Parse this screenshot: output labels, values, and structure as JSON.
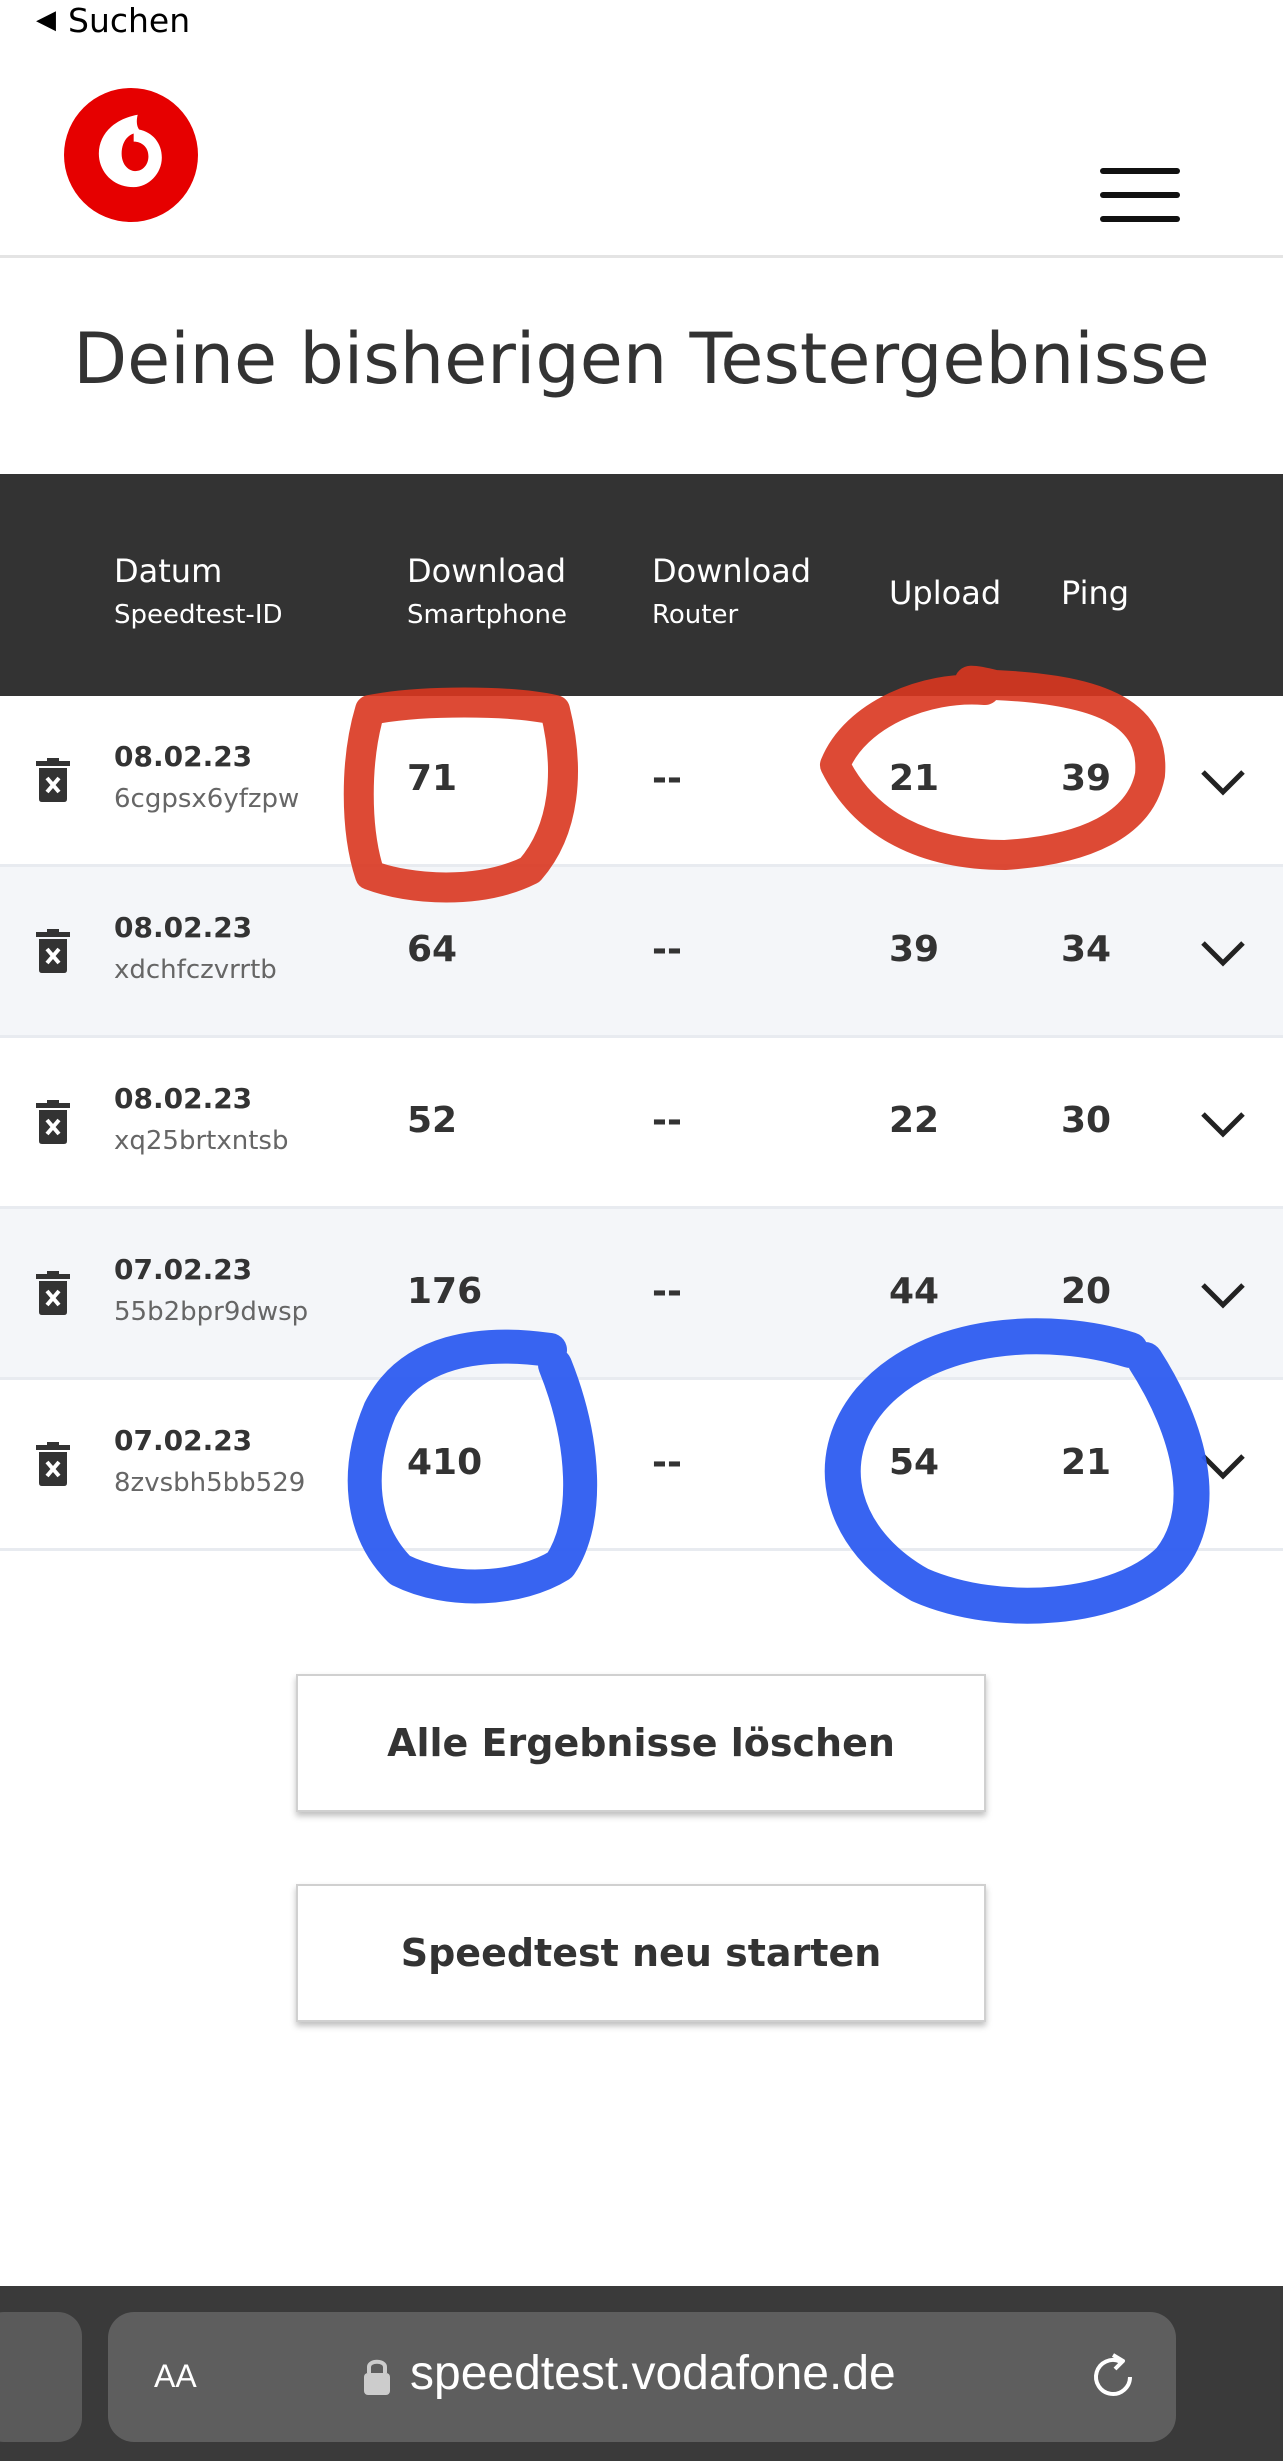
{
  "statusbar": {
    "back_label": "Suchen",
    "back_arrow": "◀"
  },
  "header": {
    "logo": "vodafone-logo",
    "menu_icon": "hamburger-menu-icon",
    "brand_color": "#e60000"
  },
  "page": {
    "title": "Deine bisherigen Testergebnisse"
  },
  "table": {
    "columns": [
      {
        "label": "Datum",
        "sublabel": "Speedtest-ID"
      },
      {
        "label": "Download",
        "sublabel": "Smartphone"
      },
      {
        "label": "Download",
        "sublabel": "Router"
      },
      {
        "label": "Upload",
        "sublabel": ""
      },
      {
        "label": "Ping",
        "sublabel": ""
      }
    ],
    "rows": [
      {
        "date": "08.02.23",
        "id": "6cgpsx6yfzpw",
        "download_smartphone": "71",
        "download_router": "--",
        "upload": "21",
        "ping": "39"
      },
      {
        "date": "08.02.23",
        "id": "xdchfczvrrtb",
        "download_smartphone": "64",
        "download_router": "--",
        "upload": "39",
        "ping": "34"
      },
      {
        "date": "08.02.23",
        "id": "xq25brtxntsb",
        "download_smartphone": "52",
        "download_router": "--",
        "upload": "22",
        "ping": "30"
      },
      {
        "date": "07.02.23",
        "id": "55b2bpr9dwsp",
        "download_smartphone": "176",
        "download_router": "--",
        "upload": "44",
        "ping": "20"
      },
      {
        "date": "07.02.23",
        "id": "8zvsbh5bb529",
        "download_smartphone": "410",
        "download_router": "--",
        "upload": "54",
        "ping": "21"
      }
    ]
  },
  "actions": {
    "delete_all_label": "Alle Ergebnisse löschen",
    "restart_label": "Speedtest neu starten"
  },
  "browser": {
    "text_size_label": "AA",
    "url": "speedtest.vodafone.de"
  },
  "annotations": {
    "red_color": "#d9361f",
    "blue_color": "#2d5cf0"
  }
}
